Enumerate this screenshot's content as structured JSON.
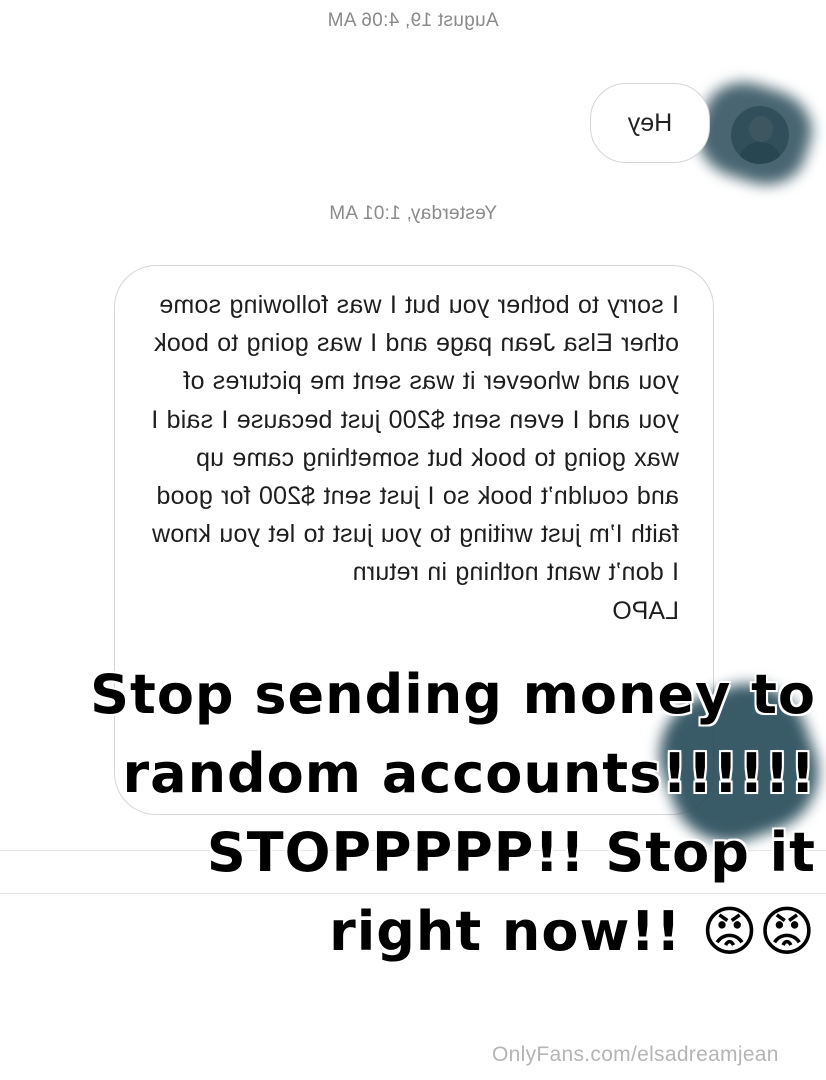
{
  "timestamps": [
    "August 19, 4:06 AM",
    "Yesterday, 1:01 AM"
  ],
  "messages": {
    "greeting": "Hey",
    "long_text": "I sorry to bother you but I was following some other Elsa Jean page and I was going to book you and whoever it was sent me pictures of you and I even sent $200  just because I said I wax going to book but something came up and couldn’t book so I just sent $200 for good faith I’m just writing to you just to let you know I don’t want nothing in return",
    "partial_line": "LAPO"
  },
  "overlay_lines": [
    "Stop sending money to",
    "random accounts!!!!!!",
    "STOPPPPP!! Stop it",
    "right now!! 😡😡"
  ],
  "watermark": "OnlyFans.com/elsadreamjean",
  "icons": {
    "avatar": "user-avatar"
  },
  "colors": {
    "smudge": "#284a58",
    "bubble_border": "#d6d6d6",
    "timestamp": "#8a8a8a"
  }
}
